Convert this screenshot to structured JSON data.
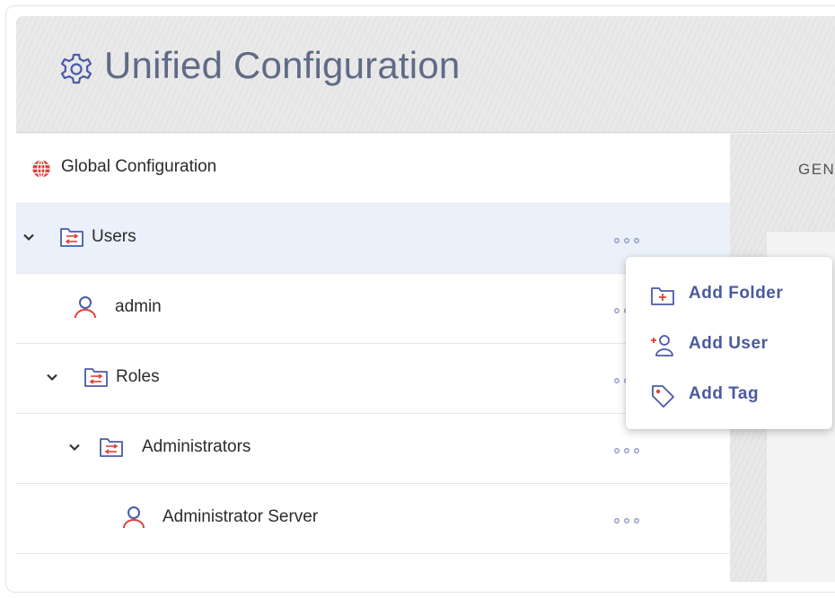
{
  "app": {
    "title": "Unified Configuration",
    "icon": "gear-icon"
  },
  "tree": {
    "global_label": "Global Configuration",
    "items": [
      {
        "label": "Users",
        "type": "folder",
        "icon": "folder-icon",
        "expanded": true,
        "selected": true
      },
      {
        "label": "admin",
        "type": "user",
        "icon": "user-icon"
      },
      {
        "label": "Roles",
        "type": "folder",
        "icon": "folder-icon",
        "expanded": true
      },
      {
        "label": "Administrators",
        "type": "folder",
        "icon": "folder-icon",
        "expanded": true
      },
      {
        "label": "Administrator Server",
        "type": "user",
        "icon": "user-icon"
      }
    ]
  },
  "right_pane": {
    "tab_label": "GEN"
  },
  "context_menu": {
    "items": [
      {
        "label": "Add Folder",
        "icon": "add-folder-icon"
      },
      {
        "label": "Add User",
        "icon": "add-user-icon"
      },
      {
        "label": "Add Tag",
        "icon": "tag-icon"
      }
    ]
  },
  "colors": {
    "title_text": "#5f6b86",
    "selected_row": "#eaf1fb",
    "menu_text": "#4a5a9c",
    "icon_red": "#e0403a",
    "icon_blue": "#4a5aa8",
    "dots": "#8a93c8"
  }
}
